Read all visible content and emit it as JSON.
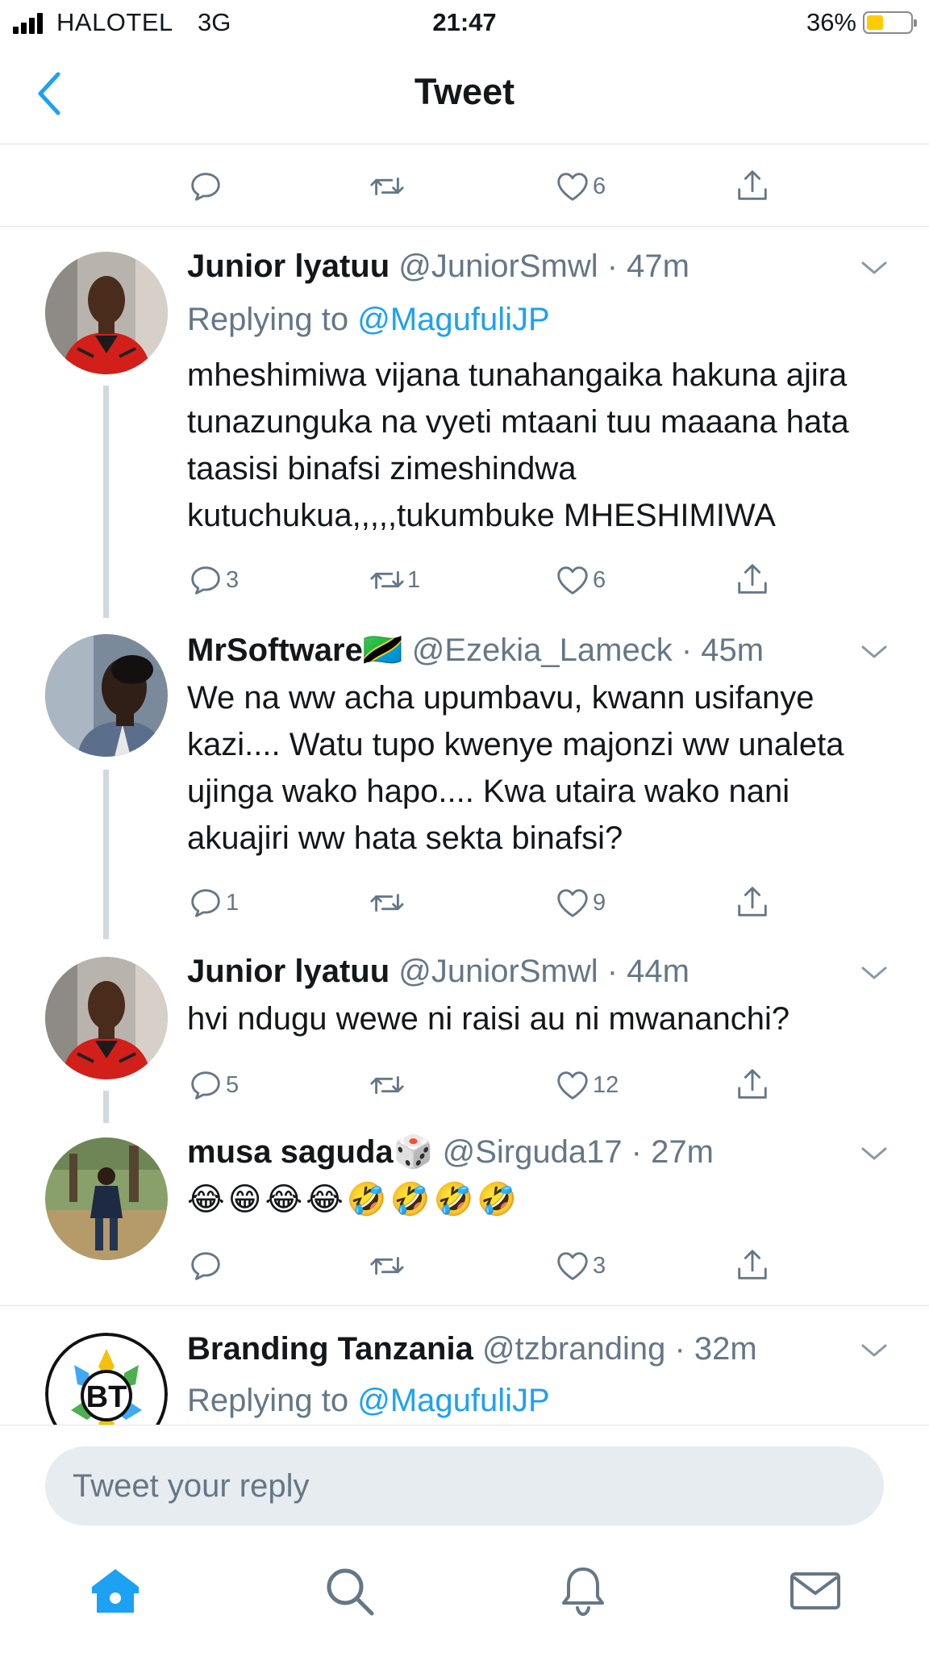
{
  "status_bar": {
    "carrier": "HALOTEL",
    "network": "3G",
    "time": "21:47",
    "battery": "36%"
  },
  "nav": {
    "title": "Tweet"
  },
  "top_actions": {
    "like_count": "6"
  },
  "tweets": [
    {
      "name": "Junior lyatuu",
      "handle": "@JuniorSmwl",
      "time": "47m",
      "replying_prefix": "Replying to",
      "replying_to": "@MagufuliJP",
      "text": "mheshimiwa vijana tunahangaika hakuna ajira tunazunguka na vyeti mtaani tuu maaana hata taasisi binafsi zimeshindwa kutuchukua,,,,,tukumbuke MHESHIMIWA",
      "replies": "3",
      "retweets": "1",
      "likes": "6"
    },
    {
      "name": "MrSoftware",
      "name_emoji": "🇹🇿",
      "handle": "@Ezekia_Lameck",
      "time": "45m",
      "text": "We na ww acha upumbavu, kwann usifanye kazi.... Watu tupo kwenye majonzi ww unaleta ujinga wako hapo.... Kwa utaira wako nani akuajiri ww hata sekta binafsi?",
      "replies": "1",
      "retweets": "",
      "likes": "9"
    },
    {
      "name": "Junior lyatuu",
      "handle": "@JuniorSmwl",
      "time": "44m",
      "text": "hvi ndugu wewe ni raisi au ni mwananchi?",
      "replies": "5",
      "retweets": "",
      "likes": "12"
    },
    {
      "name": "musa saguda",
      "name_emoji": "🎲",
      "handle": "@Sirguda17",
      "time": "27m",
      "text": "😂😁😂😂🤣🤣🤣🤣",
      "replies": "",
      "retweets": "",
      "likes": "3"
    },
    {
      "name": "Branding Tanzania",
      "handle": "@tzbranding",
      "time": "32m",
      "replying_prefix": "Replying to",
      "replying_to": "@MagufuliJP",
      "avatar_text": "BT"
    }
  ],
  "reply_box": {
    "placeholder": "Tweet your reply"
  },
  "tab_bar": {
    "icons": [
      "home-icon",
      "search-icon",
      "notifications-icon",
      "messages-icon"
    ],
    "active": "home-icon",
    "accent": "#1da1f2"
  }
}
